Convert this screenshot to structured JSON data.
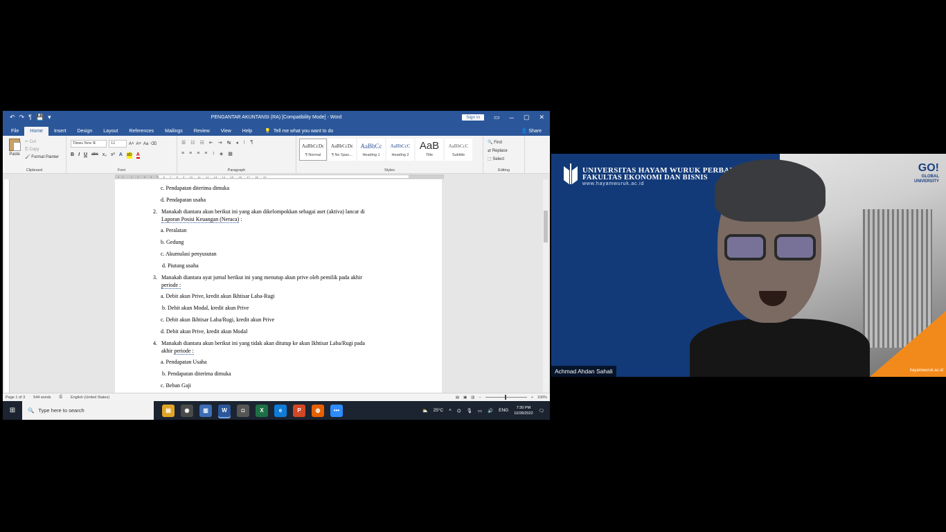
{
  "word": {
    "qat": [
      "↶",
      "↷",
      "¶",
      "💾",
      "▾"
    ],
    "title": "PENGANTAR AKUNTANSI (RA) [Compatibility Mode] - Word",
    "signin": "Sign in",
    "window_controls": [
      "▭",
      "─",
      "▢",
      "✕"
    ],
    "tabs": [
      "File",
      "Home",
      "Insert",
      "Design",
      "Layout",
      "References",
      "Mailings",
      "Review",
      "View",
      "Help"
    ],
    "active_tab": "Home",
    "tell_me": "Tell me what you want to do",
    "share": "Share",
    "ribbon": {
      "clipboard": {
        "name": "Clipboard",
        "paste": "Paste",
        "cut": "Cut",
        "copy": "Copy",
        "format_painter": "Format Painter"
      },
      "font": {
        "name": "Font",
        "family": "Times New R",
        "size": "12",
        "grow": "A˄",
        "shrink": "A˅",
        "case": "Aa",
        "clear": "⌫",
        "bold": "B",
        "italic": "I",
        "underline": "U",
        "strike": "abc",
        "sub": "x₂",
        "sup": "x²",
        "effects": "A",
        "highlight": "ab",
        "color": "A"
      },
      "paragraph": {
        "name": "Paragraph",
        "row1": [
          "☰",
          "☷",
          "☵",
          "⇤",
          "⇥",
          "↹",
          "◂",
          "↕",
          "¶"
        ],
        "row2": [
          "≡",
          "≡",
          "≡",
          "≡",
          "↕",
          "◈",
          "▦"
        ]
      },
      "styles": {
        "name": "Styles",
        "items": [
          {
            "preview": "AaBbCcDc",
            "name": "¶ Normal"
          },
          {
            "preview": "AaBbCcDc",
            "name": "¶ No Spac..."
          },
          {
            "preview": "AaBbCc",
            "name": "Heading 1"
          },
          {
            "preview": "AaBbCcC",
            "name": "Heading 2"
          },
          {
            "preview": "AaB",
            "name": "Title"
          },
          {
            "preview": "AaBbCcC",
            "name": "Subtitle"
          }
        ]
      },
      "editing": {
        "name": "Editing",
        "find": "Find",
        "replace": "Replace",
        "select": "Select"
      }
    },
    "ruler_marks": "· 2 · 1 · · · 1 · · 2 · · 3 · · 4 · · 5 · · 6 · · 7 · · 8 · · 9 · · 10 · · 11 · · 12 · · 13 · · 14 · · 15 · · 16 · · 17 · · 18 · · 19",
    "document": {
      "q1_opts": [
        "c. Pendapatan diterima dimuka",
        "d. Pendapatan usaha"
      ],
      "q2": {
        "num": "2.",
        "line1": "Manakah diantara akun berikut ini yang akan dikelompokkan sebagai aset (aktiva) lancar di",
        "line2": "Laporan Posisi Keuangan (Neraca)",
        "tail": " :"
      },
      "q2_opts": [
        "a. Peralatan",
        "b. Gedung",
        "c. Akumulasi penyusutan",
        "d. Piutang usaha"
      ],
      "q3": {
        "num": "3.",
        "line1": "Manakah diantara ayat jurnal berikut ini yang menutup akun prive oleh pemilik pada akhir",
        "line2": "periode :"
      },
      "q3_opts": [
        "a. Debit akun Prive, kredit akun Ikhtisar Laba-Rugi",
        "b. Debit akun Modal, kredit akun Prive",
        "c. Debit akun Ikhtisar Laba/Rugi, kredit akun Prive",
        "d. Debit akun Prive, kredit akun Modal"
      ],
      "q4": {
        "num": "4.",
        "line1": "Manakah diantara akun berikut ini yang tidak akan ditutup ke akun Ikhtisar Laba/Rugi pada",
        "line2a": "akhir ",
        "line2b": "periode :"
      },
      "q4_opts": [
        "a. Pendapatan Usaha",
        "b. Pendapatan diterima dimuka",
        "c. Beban Gaji"
      ]
    },
    "status": {
      "page": "Page 1 of 3",
      "words": "544 words",
      "language": "English (United States)",
      "zoom": "100%"
    }
  },
  "taskbar": {
    "search_placeholder": "Type here to search",
    "apps": [
      {
        "label": "▤",
        "color": "#e0a526"
      },
      {
        "label": "◉",
        "color": "#4a4a4a"
      },
      {
        "label": "▥",
        "color": "#3c6db5"
      },
      {
        "label": "W",
        "color": "#2b579a"
      },
      {
        "label": "◘",
        "color": "#555555"
      },
      {
        "label": "X",
        "color": "#1d7044"
      },
      {
        "label": "e",
        "color": "#0f7bd8"
      },
      {
        "label": "P",
        "color": "#d24726"
      },
      {
        "label": "◍",
        "color": "#e66000"
      },
      {
        "label": "•••",
        "color": "#2d8cff"
      }
    ],
    "weather": "25°C",
    "lang": "ENG",
    "time": "7:30 PM",
    "date": "10/28/2022"
  },
  "webcam": {
    "uni_line1": "UNIVERSITAS HAYAM WURUK PERBANAS",
    "uni_line2": "FAKULTAS EKONOMI DAN BISNIS",
    "uni_url": "www.hayamwuruk.ac.id",
    "go_big": "GO!",
    "go_line1": "GLOBAL",
    "go_line2": "UNIVERSITY",
    "name": "Achmad Ahdan Sahali",
    "footer_url": "hayamwuruk.ac.id"
  }
}
